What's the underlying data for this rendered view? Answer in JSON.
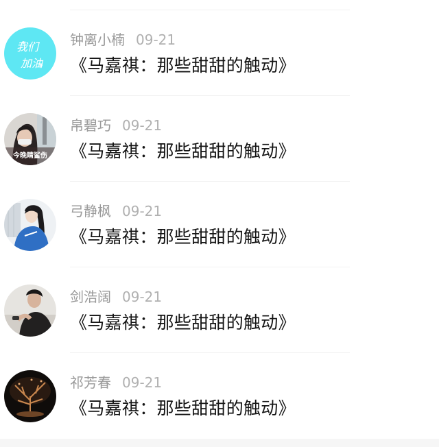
{
  "comments": [
    {
      "username": "钟离小楠",
      "date": "09-21",
      "title": "《马嘉祺：那些甜甜的触动》",
      "avatar_text": [
        "我们",
        "加油"
      ]
    },
    {
      "username": "帛碧巧",
      "date": "09-21",
      "title": "《马嘉祺：那些甜甜的触动》",
      "avatar_text": "今晚睛鲨伤"
    },
    {
      "username": "弓静枫",
      "date": "09-21",
      "title": "《马嘉祺：那些甜甜的触动》"
    },
    {
      "username": "剑浩阔",
      "date": "09-21",
      "title": "《马嘉祺：那些甜甜的触动》"
    },
    {
      "username": "祁芳春",
      "date": "09-21",
      "title": "《马嘉祺：那些甜甜的触动》"
    }
  ],
  "colors": {
    "username": "#9a9a9a",
    "date": "#b0b0b0",
    "title": "#141414",
    "divider": "#f1f1f1",
    "avatar_1_bg": "#5ee7f3"
  }
}
